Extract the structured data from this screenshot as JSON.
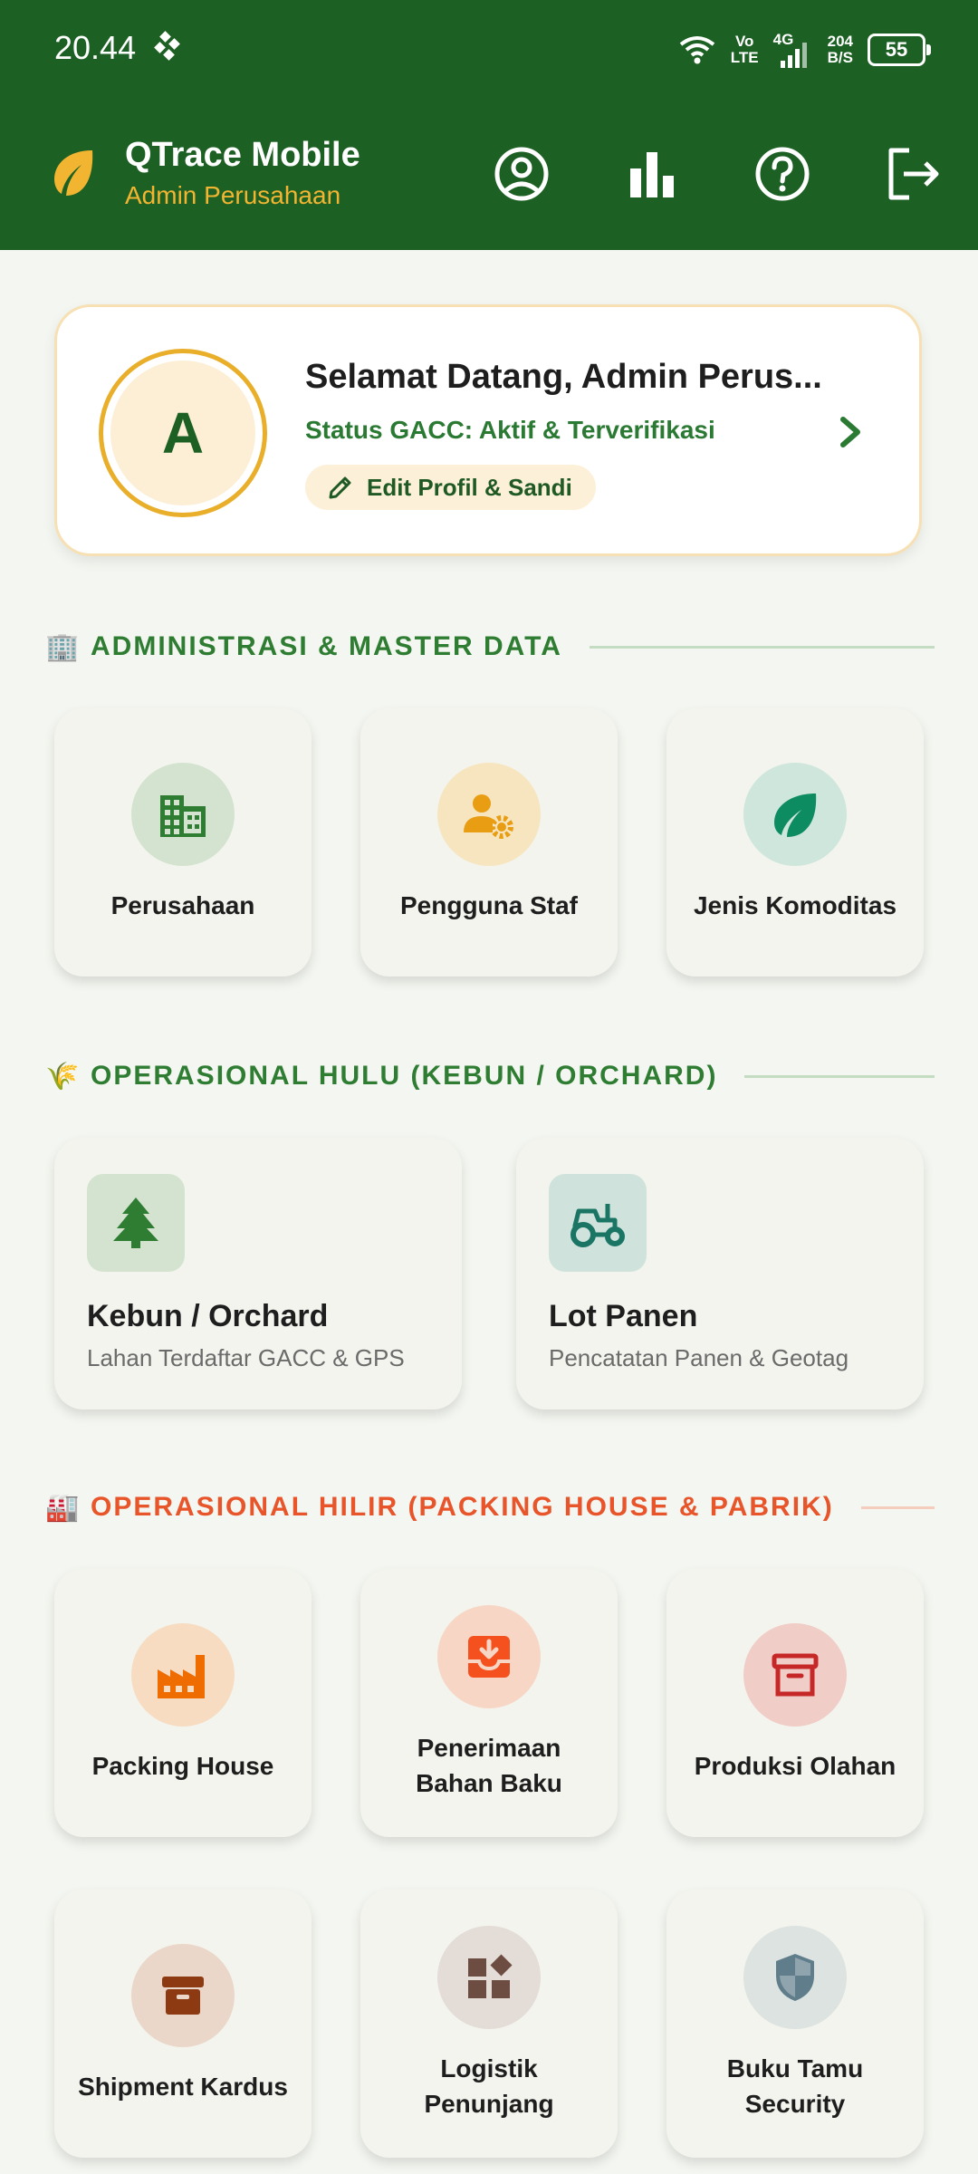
{
  "status_bar": {
    "time": "20.44",
    "volte_top": "Vo",
    "volte_bottom": "LTE",
    "network": "4G",
    "speed_top": "204",
    "speed_bottom": "B/S",
    "battery": "55"
  },
  "app_bar": {
    "title": "QTrace Mobile",
    "subtitle": "Admin Perusahaan",
    "icons": [
      "leaf-icon",
      "profile-icon",
      "bar-chart-icon",
      "help-icon",
      "logout-icon"
    ]
  },
  "welcome": {
    "avatar_letter": "A",
    "title": "Selamat Datang, Admin Perus...",
    "status": "Status GACC: Aktif & Terverifikasi",
    "edit_label": "Edit Profil & Sandi"
  },
  "sections": {
    "admin": {
      "emoji": "🏢",
      "title": "ADMINISTRASI & MASTER DATA",
      "color": "#2e7d32",
      "items": [
        {
          "label": "Perusahaan",
          "icon": "building-icon"
        },
        {
          "label": "Pengguna Staf",
          "icon": "user-gear-icon"
        },
        {
          "label": "Jenis Komoditas",
          "icon": "leaf-icon"
        }
      ]
    },
    "hulu": {
      "emoji": "🌾",
      "title": "OPERASIONAL HULU (KEBUN / ORCHARD)",
      "color": "#2e7d32",
      "items": [
        {
          "title": "Kebun / Orchard",
          "subtitle": "Lahan Terdaftar GACC & GPS",
          "icon": "tree-icon"
        },
        {
          "title": "Lot Panen",
          "subtitle": "Pencatatan Panen & Geotag",
          "icon": "tractor-icon"
        }
      ]
    },
    "hilir": {
      "emoji": "🏭",
      "title": "OPERASIONAL HILIR (PACKING HOUSE & PABRIK)",
      "color": "#e8552b",
      "items": [
        {
          "line1": "Packing House",
          "line2": "",
          "icon": "factory-icon"
        },
        {
          "line1": "Penerimaan",
          "line2": "Bahan Baku",
          "icon": "inbox-download-icon"
        },
        {
          "line1": "Produksi Olahan",
          "line2": "",
          "icon": "archive-icon"
        },
        {
          "line1": "Shipment Kardus",
          "line2": "",
          "icon": "box-icon"
        },
        {
          "line1": "Logistik",
          "line2": "Penunjang",
          "icon": "widgets-icon"
        },
        {
          "line1": "Buku Tamu",
          "line2": "Security",
          "icon": "shield-icon"
        }
      ]
    }
  },
  "colors": {
    "primary": "#1d6024",
    "accent": "#f2b531",
    "hilir": "#e8552b"
  }
}
